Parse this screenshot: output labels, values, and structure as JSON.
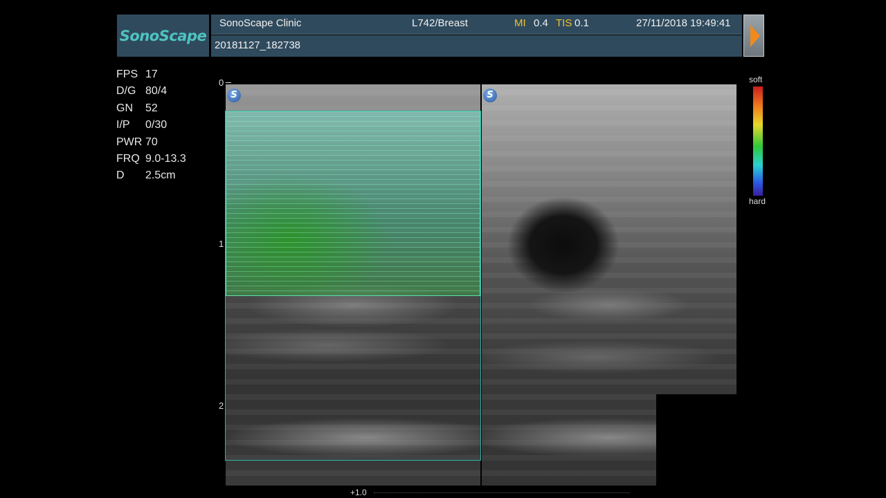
{
  "header": {
    "logo": "SonoScape",
    "clinic": "SonoScape Clinic",
    "probe_preset": "L742/Breast",
    "mi_label": "MI",
    "mi_value": "0.4",
    "tis_label": "TIS",
    "tis_value": "0.1",
    "datetime": "27/11/2018 19:49:41",
    "patient_id": "20181127_182738"
  },
  "params": [
    {
      "name": "FPS",
      "value": "17"
    },
    {
      "name": "D/G",
      "value": "80/4"
    },
    {
      "name": "GN",
      "value": "52"
    },
    {
      "name": "I/P",
      "value": "0/30"
    },
    {
      "name": "PWR",
      "value": "70"
    },
    {
      "name": "FRQ",
      "value": "9.0-13.3"
    },
    {
      "name": "D",
      "value": "2.5cm"
    }
  ],
  "depth_scale": {
    "labels": [
      "0",
      "1",
      "2"
    ]
  },
  "color_bar": {
    "top_label": "soft",
    "bottom_label": "hard"
  },
  "badges": {
    "left": "S",
    "right": "S"
  },
  "bottom_label": "+1.0",
  "colors": {
    "header_bg": "#2f4a5d",
    "logo": "#4fc3c0",
    "accent_yellow": "#f2c12e",
    "roi": "#2fb5a6"
  }
}
